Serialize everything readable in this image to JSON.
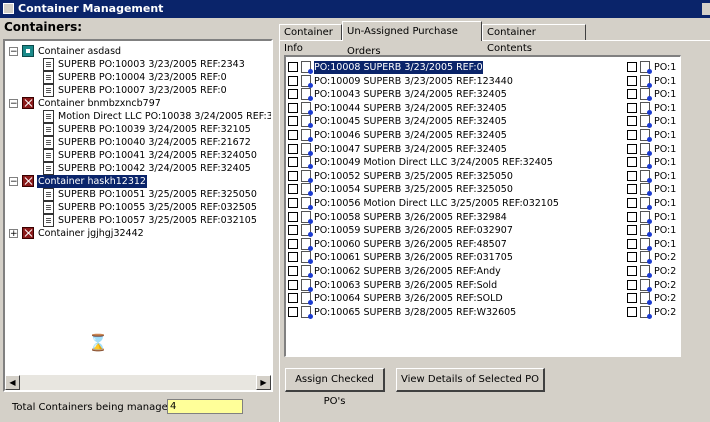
{
  "window": {
    "title": "Container Management"
  },
  "containers_label": "Containers:",
  "tree": [
    {
      "label": "Container asdasd",
      "expander": "−",
      "icon": "teal",
      "selected": false,
      "children": [
        "SUPERB  PO:10003  3/23/2005  REF:2343",
        "SUPERB  PO:10004  3/23/2005  REF:0",
        "SUPERB  PO:10007  3/23/2005  REF:0"
      ]
    },
    {
      "label": "Container bnmbzxncb797",
      "expander": "−",
      "icon": "red",
      "selected": false,
      "children": [
        "Motion Direct LLC  PO:10038  3/24/2005  REF:3",
        "SUPERB  PO:10039  3/24/2005  REF:32105",
        "SUPERB  PO:10040  3/24/2005  REF:21672",
        "SUPERB  PO:10041  3/24/2005  REF:324050",
        "SUPERB  PO:10042  3/24/2005  REF:32405"
      ]
    },
    {
      "label": "Container haskh12312",
      "expander": "−",
      "icon": "red",
      "selected": true,
      "children": [
        "SUPERB  PO:10051  3/25/2005  REF:325050",
        "SUPERB  PO:10055  3/25/2005  REF:032505",
        "SUPERB  PO:10057  3/25/2005  REF:032105"
      ]
    },
    {
      "label": "Container jgjhgj32442",
      "expander": "+",
      "icon": "red",
      "selected": false,
      "children": []
    }
  ],
  "total_label": "Total Containers being managed:",
  "total_value": "4",
  "tabs": [
    "Container Info",
    "Un-Assigned Purchase Orders",
    "Container Contents"
  ],
  "active_tab": 1,
  "po_rows": [
    "PO:10008 SUPERB  3/23/2005  REF:0",
    "PO:10009 SUPERB  3/23/2005  REF:123440",
    "PO:10043 SUPERB  3/24/2005  REF:32405",
    "PO:10044 SUPERB  3/24/2005  REF:32405",
    "PO:10045 SUPERB  3/24/2005  REF:32405",
    "PO:10046 SUPERB  3/24/2005  REF:32405",
    "PO:10047 SUPERB  3/24/2005  REF:32405",
    "PO:10049 Motion Direct LLC  3/24/2005  REF:32405",
    "PO:10052 SUPERB  3/25/2005  REF:325050",
    "PO:10054 SUPERB  3/25/2005  REF:325050",
    "PO:10056 Motion Direct LLC  3/25/2005  REF:032105",
    "PO:10058 SUPERB  3/26/2005  REF:32984",
    "PO:10059 SUPERB  3/26/2005  REF:032907",
    "PO:10060 SUPERB  3/26/2005  REF:48507",
    "PO:10061 SUPERB  3/26/2005  REF:031705",
    "PO:10062 SUPERB  3/26/2005  REF:Andy",
    "PO:10063 SUPERB  3/26/2005  REF:Sold",
    "PO:10064 SUPERB  3/26/2005  REF:SOLD",
    "PO:10065 SUPERB  3/28/2005  REF:W32605"
  ],
  "po_right_labels": [
    "PO:1",
    "PO:1",
    "PO:1",
    "PO:1",
    "PO:1",
    "PO:1",
    "PO:1",
    "PO:1",
    "PO:1",
    "PO:1",
    "PO:1",
    "PO:1",
    "PO:1",
    "PO:1",
    "PO:2",
    "PO:2",
    "PO:2",
    "PO:2",
    "PO:2"
  ],
  "buttons": {
    "assign": "Assign Checked PO's",
    "view_details": "View Details of Selected PO"
  }
}
